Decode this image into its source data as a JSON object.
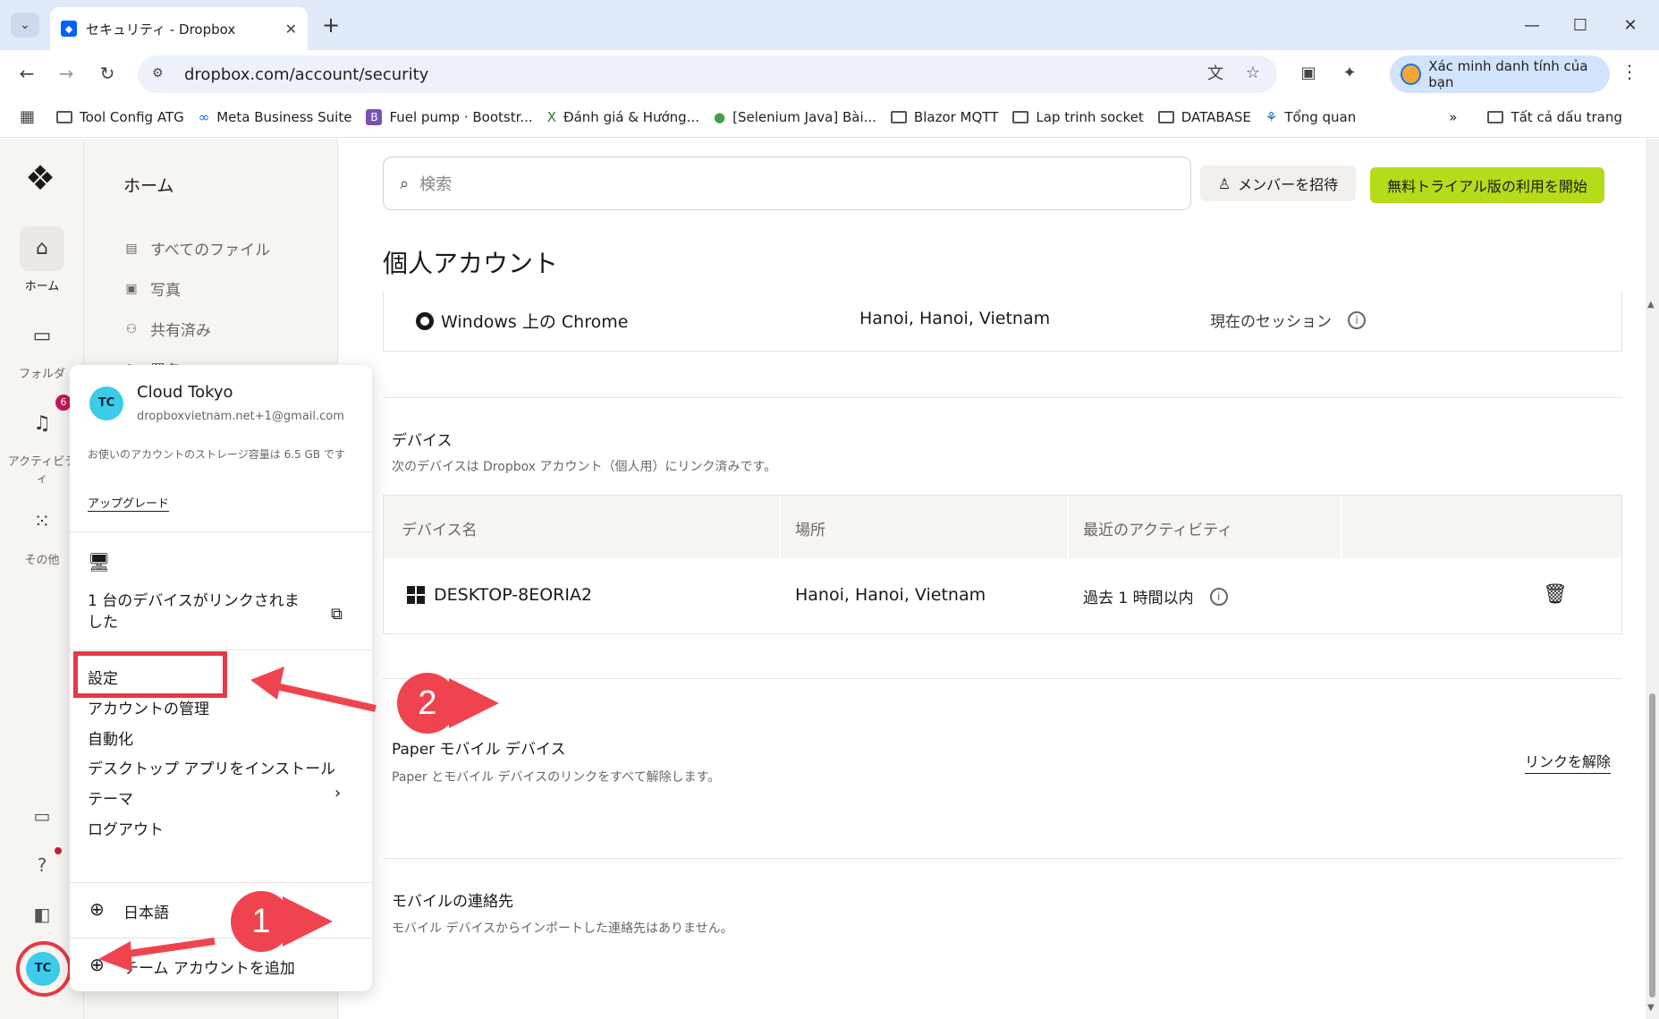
{
  "browser": {
    "tab_title": "セキュリティ - Dropbox",
    "url": "dropbox.com/account/security",
    "profile_label": "Xác minh danh tính của bạn",
    "bookmarks": [
      "Tool Config ATG",
      "Meta Business Suite",
      "Fuel pump · Bootstr...",
      "Đánh giá & Hướng...",
      "[Selenium Java] Bài...",
      "Blazor MQTT",
      "Lap trinh socket",
      "DATABASE",
      "Tổng quan"
    ],
    "bookmarks_all": "Tất cả dấu trang"
  },
  "rail": {
    "home": "ホーム",
    "folders": "フォルダ",
    "activity": "アクティビティ",
    "other": "その他",
    "badge_count": "6",
    "avatar": "TC"
  },
  "subnav": {
    "title": "ホーム",
    "items": [
      "すべてのファイル",
      "写真",
      "共有済み",
      "署名"
    ]
  },
  "header": {
    "search_placeholder": "検索",
    "invite_label": "メンバーを招待",
    "trial_label": "無料トライアル版の利用を開始"
  },
  "main": {
    "page_title": "個人アカウント",
    "session": {
      "browser": "Windows 上の Chrome",
      "location": "Hanoi, Hanoi, Vietnam",
      "status": "現在のセッション"
    },
    "devices": {
      "title": "デバイス",
      "subtitle": "次のデバイスは Dropbox アカウント（個人用）にリンク済みです。",
      "columns": [
        "デバイス名",
        "場所",
        "最近のアクティビティ"
      ],
      "rows": [
        {
          "name": "DESKTOP-8EORIA2",
          "location": "Hanoi, Hanoi, Vietnam",
          "activity": "過去 1 時間以内"
        }
      ]
    },
    "paper": {
      "title": "Paper モバイル デバイス",
      "subtitle": "Paper とモバイル デバイスのリンクをすべて解除します。",
      "unlink_label": "リンクを解除"
    },
    "contacts": {
      "title": "モバイルの連絡先",
      "subtitle": "モバイル デバイスからインポートした連絡先はありません。"
    }
  },
  "menu": {
    "avatar": "TC",
    "name": "Cloud Tokyo",
    "email": "dropboxvietnam.net+1@gmail.com",
    "storage": "お使いのアカウントのストレージ容量は 6.5 GB です",
    "upgrade": "アップグレード",
    "devices_linked": "1 台のデバイスがリンクされました",
    "items": [
      "設定",
      "アカウントの管理",
      "自動化",
      "デスクトップ アプリをインストール",
      "テーマ",
      "ログアウト"
    ],
    "language": "日本語",
    "add_team": "チーム アカウントを追加"
  },
  "annotations": {
    "step1": "1",
    "step2": "2",
    "color": "#ef4450"
  }
}
